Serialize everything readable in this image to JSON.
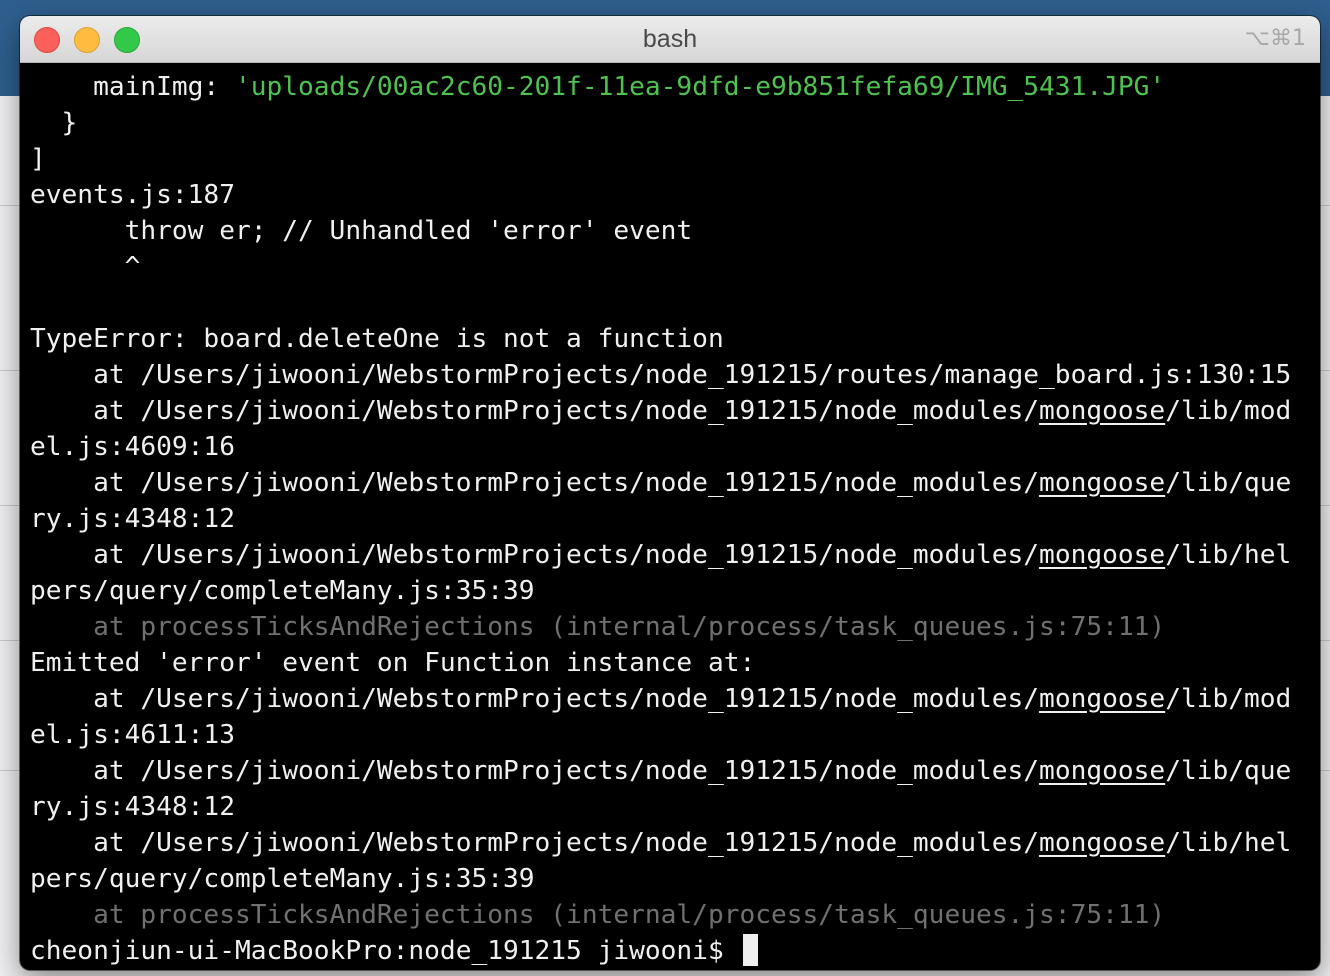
{
  "window": {
    "title": "bash",
    "shortcut": "⌥⌘1"
  },
  "terminal": {
    "lines": [
      {
        "segments": [
          {
            "text": "    mainImg: "
          },
          {
            "text": "'uploads/00ac2c60-201f-11ea-9dfd-e9b851fefa69/IMG_5431.JPG'",
            "style": "str"
          }
        ]
      },
      {
        "segments": [
          {
            "text": "  }"
          }
        ]
      },
      {
        "segments": [
          {
            "text": "]"
          }
        ]
      },
      {
        "segments": [
          {
            "text": "events.js:187"
          }
        ]
      },
      {
        "segments": [
          {
            "text": "      throw er; // Unhandled 'error' event"
          }
        ]
      },
      {
        "segments": [
          {
            "text": "      ^"
          }
        ]
      },
      {
        "segments": [
          {
            "text": ""
          }
        ]
      },
      {
        "segments": [
          {
            "text": "TypeError: board.deleteOne is not a function"
          }
        ]
      },
      {
        "segments": [
          {
            "text": "    at /Users/jiwooni/WebstormProjects/node_191215/routes/manage_board.js:130:15"
          }
        ]
      },
      {
        "segments": [
          {
            "text": "    at /Users/jiwooni/WebstormProjects/node_191215/node_modules/"
          },
          {
            "text": "mongoose",
            "style": "ul"
          },
          {
            "text": "/lib/mod"
          }
        ]
      },
      {
        "segments": [
          {
            "text": "el.js:4609:16"
          }
        ]
      },
      {
        "segments": [
          {
            "text": "    at /Users/jiwooni/WebstormProjects/node_191215/node_modules/"
          },
          {
            "text": "mongoose",
            "style": "ul"
          },
          {
            "text": "/lib/que"
          }
        ]
      },
      {
        "segments": [
          {
            "text": "ry.js:4348:12"
          }
        ]
      },
      {
        "segments": [
          {
            "text": "    at /Users/jiwooni/WebstormProjects/node_191215/node_modules/"
          },
          {
            "text": "mongoose",
            "style": "ul"
          },
          {
            "text": "/lib/hel"
          }
        ]
      },
      {
        "segments": [
          {
            "text": "pers/query/completeMany.js:35:39"
          }
        ]
      },
      {
        "segments": [
          {
            "text": "    at processTicksAndRejections (internal/process/task_queues.js:75:11)",
            "style": "dim"
          }
        ]
      },
      {
        "segments": [
          {
            "text": "Emitted 'error' event on Function instance at:"
          }
        ]
      },
      {
        "segments": [
          {
            "text": "    at /Users/jiwooni/WebstormProjects/node_191215/node_modules/"
          },
          {
            "text": "mongoose",
            "style": "ul"
          },
          {
            "text": "/lib/mod"
          }
        ]
      },
      {
        "segments": [
          {
            "text": "el.js:4611:13"
          }
        ]
      },
      {
        "segments": [
          {
            "text": "    at /Users/jiwooni/WebstormProjects/node_191215/node_modules/"
          },
          {
            "text": "mongoose",
            "style": "ul"
          },
          {
            "text": "/lib/que"
          }
        ]
      },
      {
        "segments": [
          {
            "text": "ry.js:4348:12"
          }
        ]
      },
      {
        "segments": [
          {
            "text": "    at /Users/jiwooni/WebstormProjects/node_191215/node_modules/"
          },
          {
            "text": "mongoose",
            "style": "ul"
          },
          {
            "text": "/lib/hel"
          }
        ]
      },
      {
        "segments": [
          {
            "text": "pers/query/completeMany.js:35:39"
          }
        ]
      },
      {
        "segments": [
          {
            "text": "    at processTicksAndRejections (internal/process/task_queues.js:75:11)",
            "style": "dim"
          }
        ]
      }
    ],
    "prompt": "cheonjiun-ui-MacBookPro:node_191215 jiwooni$ "
  },
  "colors": {
    "string": "#4ec24e",
    "dim": "#707070",
    "foreground": "#f0f0f0",
    "background": "#000000"
  }
}
